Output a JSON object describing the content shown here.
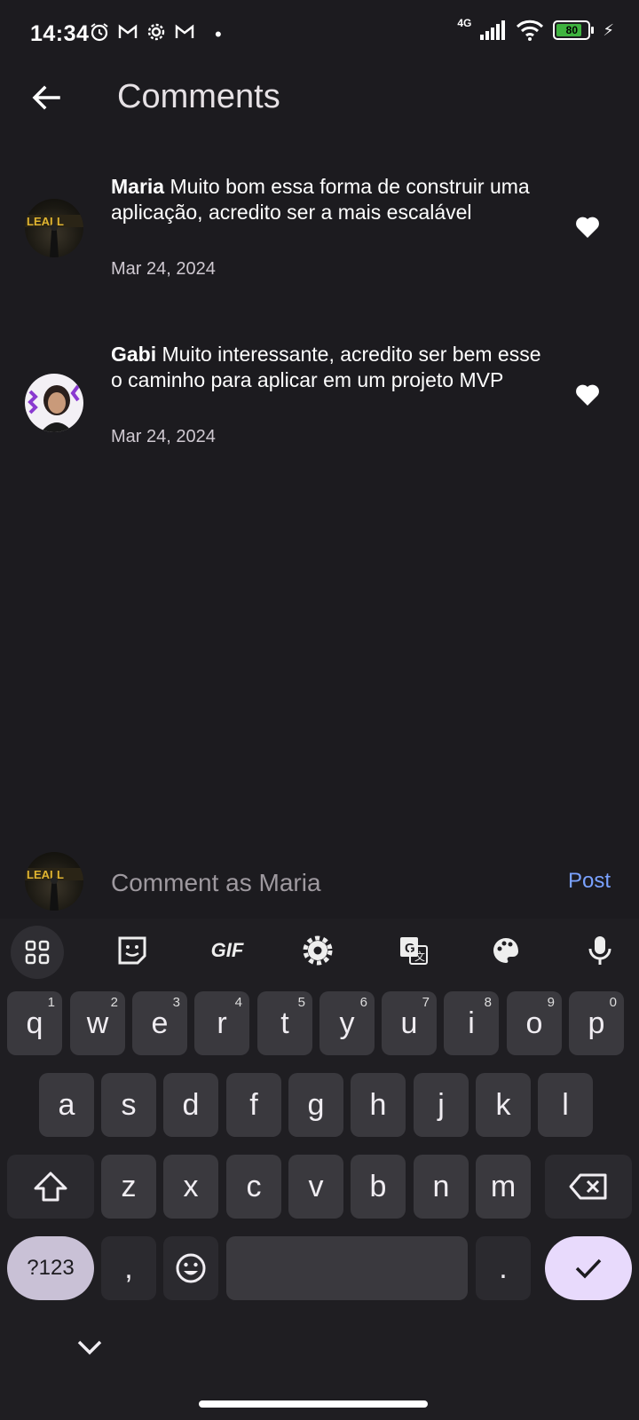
{
  "status_bar": {
    "time": "14:34",
    "network": "4G",
    "battery": "80"
  },
  "header": {
    "title": "Comments"
  },
  "comments": [
    {
      "user": "Maria",
      "text": " Muito bom essa  forma de construir uma aplicação, acredito ser a mais escalável",
      "date": "Mar 24, 2024"
    },
    {
      "user": "Gabi",
      "text": " Muito interessante, acredito ser bem esse o caminho para aplicar em um projeto MVP",
      "date": "Mar 24, 2024"
    }
  ],
  "compose": {
    "placeholder": "Comment as Maria",
    "post_label": "Post"
  },
  "keyboard": {
    "toolbar_gif": "GIF",
    "row1": [
      "q",
      "w",
      "e",
      "r",
      "t",
      "y",
      "u",
      "i",
      "o",
      "p"
    ],
    "row1_hints": [
      "1",
      "2",
      "3",
      "4",
      "5",
      "6",
      "7",
      "8",
      "9",
      "0"
    ],
    "row2": [
      "a",
      "s",
      "d",
      "f",
      "g",
      "h",
      "j",
      "k",
      "l"
    ],
    "row3": [
      "z",
      "x",
      "c",
      "v",
      "b",
      "n",
      "m"
    ],
    "sym_label": "?123",
    "comma": ",",
    "period": "."
  },
  "colors": {
    "background": "#1c1b1f",
    "accent_post": "#7aa2ff",
    "enter_key": "#e8dafc",
    "battery_fill": "#3fb33f"
  }
}
